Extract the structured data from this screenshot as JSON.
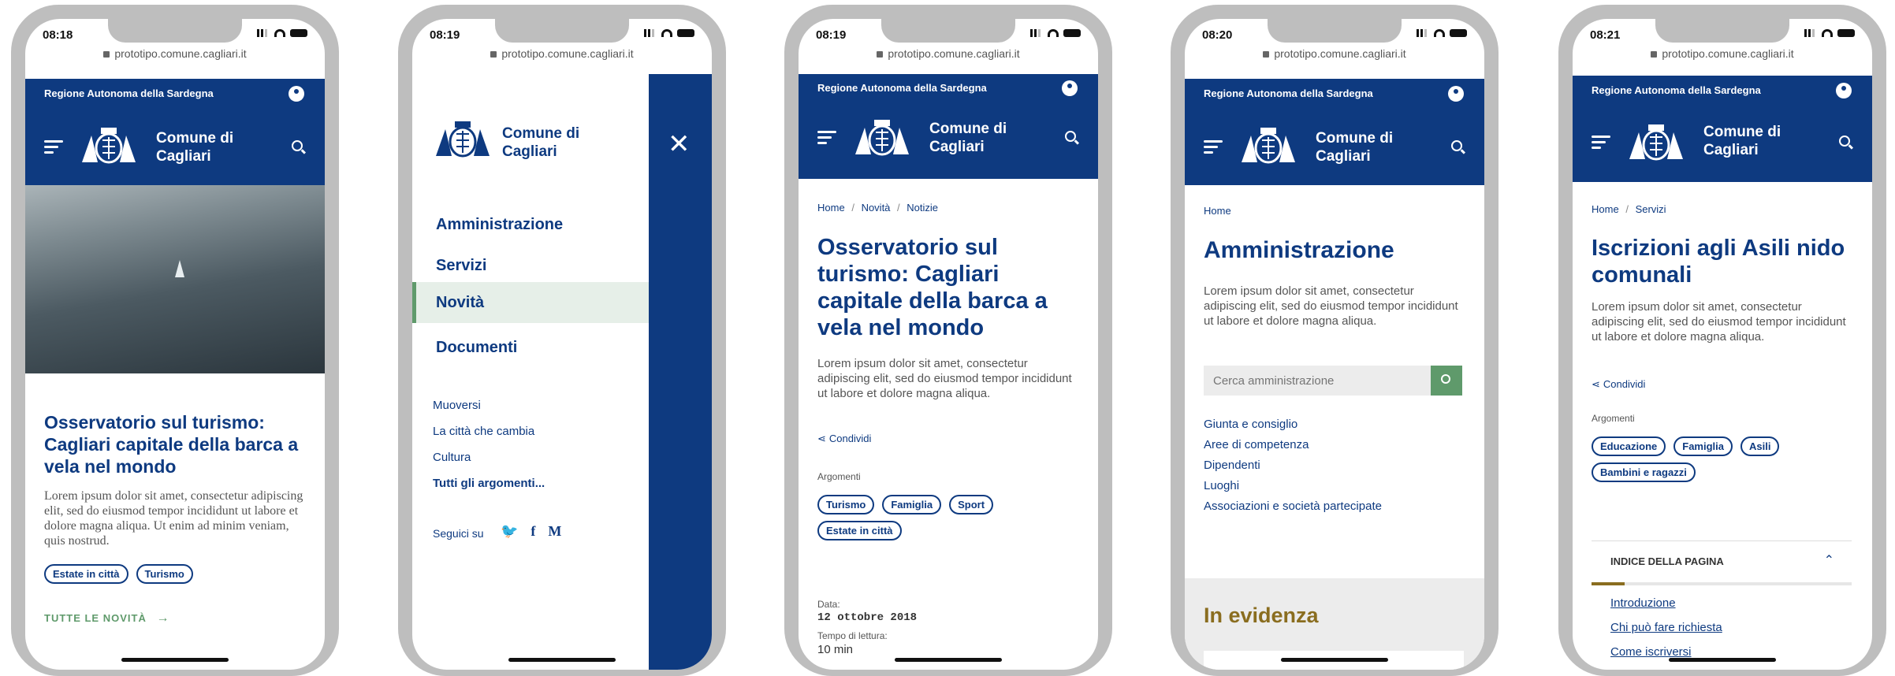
{
  "screens": [
    {
      "time": "08:18",
      "url": "prototipo.comune.cagliari.it",
      "region": "Regione Autonoma della Sardegna",
      "brand": "Comune di\nCagliari",
      "article_title": "Osservatorio sul turismo: Cagliari capitale della barca a vela nel mondo",
      "lorem": "Lorem ipsum dolor sit amet, consectetur adipiscing elit, sed do eiusmod tempor incididunt ut labore et dolore magna aliqua. Ut enim ad minim veniam, quis nostrud.",
      "tags": [
        "Estate in città",
        "Turismo"
      ],
      "all_news": "TUTTE LE NOVITÀ"
    },
    {
      "time": "08:19",
      "url": "prototipo.comune.cagliari.it",
      "brand": "Comune di\nCagliari",
      "menu": [
        "Amministrazione",
        "Servizi",
        "Novità",
        "Documenti"
      ],
      "active_menu": "Novità",
      "topics": [
        "Muoversi",
        "La città che cambia",
        "Cultura"
      ],
      "all_topics": "Tutti gli argomenti...",
      "follow": "Seguici su"
    },
    {
      "time": "08:19",
      "url": "prototipo.comune.cagliari.it",
      "region": "Regione Autonoma della Sardegna",
      "brand": "Comune di\nCagliari",
      "breadcrumb": [
        "Home",
        "Novità",
        "Notizie"
      ],
      "title": "Osservatorio sul turismo: Cagliari capitale della barca a vela nel mondo",
      "lorem": "Lorem ipsum dolor sit amet, consectetur adipiscing elit, sed do eiusmod tempor incididunt ut labore et dolore magna aliqua.",
      "share": "Condividi",
      "topics_label": "Argomenti",
      "tags": [
        "Turismo",
        "Famiglia",
        "Sport",
        "Estate in città"
      ],
      "date_label": "Data:",
      "date": "12 ottobre 2018",
      "reading_label": "Tempo di lettura:",
      "reading": "10 min"
    },
    {
      "time": "08:20",
      "url": "prototipo.comune.cagliari.it",
      "region": "Regione Autonoma della Sardegna",
      "brand": "Comune di\nCagliari",
      "breadcrumb": [
        "Home"
      ],
      "title": "Amministrazione",
      "lorem": "Lorem ipsum dolor sit amet, consectetur adipiscing elit, sed do eiusmod tempor incididunt ut labore et dolore magna aliqua.",
      "search_placeholder": "Cerca amministrazione",
      "links": [
        "Giunta e consiglio",
        "Aree di competenza",
        "Dipendenti",
        "Luoghi",
        "Associazioni e società partecipate"
      ],
      "highlight": "In evidenza"
    },
    {
      "time": "08:21",
      "url": "prototipo.comune.cagliari.it",
      "region": "Regione Autonoma della Sardegna",
      "brand": "Comune di\nCagliari",
      "breadcrumb": [
        "Home",
        "Servizi"
      ],
      "title": "Iscrizioni agli Asili nido comunali",
      "lorem": "Lorem ipsum dolor sit amet, consectetur adipiscing elit, sed do eiusmod tempor incididunt ut labore et dolore magna aliqua.",
      "share": "Condividi",
      "topics_label": "Argomenti",
      "tags": [
        "Educazione",
        "Famiglia",
        "Asili",
        "Bambini e ragazzi"
      ],
      "index_title": "INDICE DELLA PAGINA",
      "index": [
        "Introduzione",
        "Chi può fare richiesta",
        "Come iscriversi"
      ]
    }
  ],
  "colors": {
    "primary": "#0e3a80",
    "accent_green": "#5f9a6b",
    "gold": "#8a6d1f",
    "active_bg": "#e6efe8"
  }
}
